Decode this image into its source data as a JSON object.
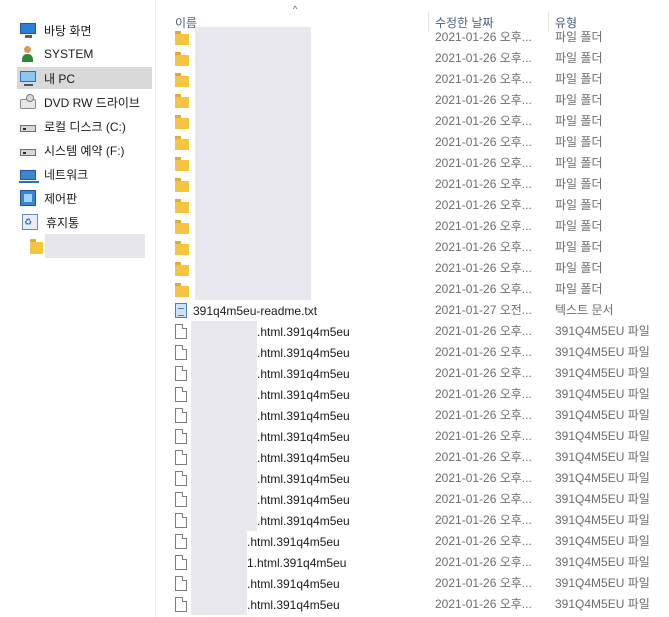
{
  "nav": {
    "items": [
      {
        "label": "바탕 화면",
        "icon": "desktop-icon"
      },
      {
        "label": "SYSTEM",
        "icon": "user-icon"
      },
      {
        "label": "내 PC",
        "icon": "pc-icon",
        "selected": true
      },
      {
        "label": "DVD RW 드라이브",
        "icon": "dvd-drive-icon"
      },
      {
        "label": "로컬 디스크 (C:)",
        "icon": "local-disk-icon"
      },
      {
        "label": "시스템 예약 (F:)",
        "icon": "system-reserved-disk-icon"
      },
      {
        "label": "네트워크",
        "icon": "network-icon"
      },
      {
        "label": "제어판",
        "icon": "control-panel-icon"
      },
      {
        "label": "휴지통",
        "icon": "recycle-bin-icon"
      },
      {
        "label": "",
        "icon": "folder-icon"
      }
    ]
  },
  "header": {
    "name": "이름",
    "date": "수정한 날짜",
    "type": "유형"
  },
  "rows": [
    {
      "kind": "folder",
      "name": "",
      "date": "2021-01-26 오후...",
      "type": "파일 폴더"
    },
    {
      "kind": "folder",
      "name": "",
      "date": "2021-01-26 오후...",
      "type": "파일 폴더"
    },
    {
      "kind": "folder",
      "name": "",
      "date": "2021-01-26 오후...",
      "type": "파일 폴더"
    },
    {
      "kind": "folder",
      "name": "",
      "date": "2021-01-26 오후...",
      "type": "파일 폴더"
    },
    {
      "kind": "folder",
      "name": "",
      "date": "2021-01-26 오후...",
      "type": "파일 폴더"
    },
    {
      "kind": "folder",
      "name": "",
      "date": "2021-01-26 오후...",
      "type": "파일 폴더"
    },
    {
      "kind": "folder",
      "name": "",
      "date": "2021-01-26 오후...",
      "type": "파일 폴더"
    },
    {
      "kind": "folder",
      "name": "",
      "date": "2021-01-26 오후...",
      "type": "파일 폴더"
    },
    {
      "kind": "folder",
      "name": "",
      "date": "2021-01-26 오후...",
      "type": "파일 폴더"
    },
    {
      "kind": "folder",
      "name": "",
      "date": "2021-01-26 오후...",
      "type": "파일 폴더"
    },
    {
      "kind": "folder",
      "name": "",
      "date": "2021-01-26 오후...",
      "type": "파일 폴더"
    },
    {
      "kind": "folder",
      "name": "",
      "date": "2021-01-26 오후...",
      "type": "파일 폴더"
    },
    {
      "kind": "folder",
      "name": "",
      "date": "2021-01-26 오후...",
      "type": "파일 폴더"
    },
    {
      "kind": "txt",
      "name": "391q4m5eu-readme.txt",
      "date": "2021-01-27 오전...",
      "type": "텍스트 문서"
    },
    {
      "kind": "file",
      "name": ".html.391q4m5eu",
      "date": "2021-01-26 오후...",
      "type": "391Q4M5EU 파일"
    },
    {
      "kind": "file",
      "name": ".html.391q4m5eu",
      "date": "2021-01-26 오후...",
      "type": "391Q4M5EU 파일"
    },
    {
      "kind": "file",
      "name": ".html.391q4m5eu",
      "date": "2021-01-26 오후...",
      "type": "391Q4M5EU 파일"
    },
    {
      "kind": "file",
      "name": ".html.391q4m5eu",
      "date": "2021-01-26 오후...",
      "type": "391Q4M5EU 파일"
    },
    {
      "kind": "file",
      "name": ".html.391q4m5eu",
      "date": "2021-01-26 오후...",
      "type": "391Q4M5EU 파일"
    },
    {
      "kind": "file",
      "name": ".html.391q4m5eu",
      "date": "2021-01-26 오후...",
      "type": "391Q4M5EU 파일"
    },
    {
      "kind": "file",
      "name": ".html.391q4m5eu",
      "date": "2021-01-26 오후...",
      "type": "391Q4M5EU 파일"
    },
    {
      "kind": "file",
      "name": ".html.391q4m5eu",
      "date": "2021-01-26 오후...",
      "type": "391Q4M5EU 파일"
    },
    {
      "kind": "file",
      "name": ".html.391q4m5eu",
      "date": "2021-01-26 오후...",
      "type": "391Q4M5EU 파일"
    },
    {
      "kind": "file",
      "name": ".html.391q4m5eu",
      "date": "2021-01-26 오후...",
      "type": "391Q4M5EU 파일"
    },
    {
      "kind": "file",
      "name": ".html.391q4m5eu",
      "date": "2021-01-26 오후...",
      "type": "391Q4M5EU 파일"
    },
    {
      "kind": "file",
      "name": "1.html.391q4m5eu",
      "date": "2021-01-26 오후...",
      "type": "391Q4M5EU 파일"
    },
    {
      "kind": "file",
      "name": ".html.391q4m5eu",
      "date": "2021-01-26 오후...",
      "type": "391Q4M5EU 파일"
    },
    {
      "kind": "file",
      "name": ".html.391q4m5eu",
      "date": "2021-01-26 오후...",
      "type": "391Q4M5EU 파일"
    }
  ]
}
